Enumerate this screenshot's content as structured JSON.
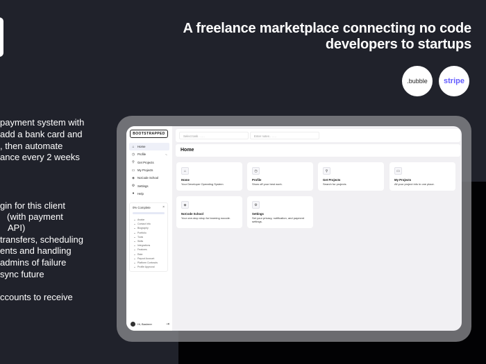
{
  "headline": [
    "A freelance marketplace connecting no code",
    "developers to startups"
  ],
  "logos": {
    "bubble": ".bubble",
    "stripe": "stripe"
  },
  "left_text": [
    "payment system with",
    "add a bank card and",
    ", then automate",
    "ance every 2 weeks",
    "gin for this client",
    "(with payment",
    "API)",
    "transfers, scheduling",
    "ents and handling",
    "admins of failure",
    "sync future",
    "ccounts to receive"
  ],
  "app": {
    "brand": "BOOTSTRAPPED",
    "nav": [
      {
        "label": "Home",
        "icon": "⌂"
      },
      {
        "label": "Profile",
        "icon": "◷",
        "badge": "‹-"
      },
      {
        "label": "Get Projects",
        "icon": "⚲"
      },
      {
        "label": "My Projects",
        "icon": "▭"
      },
      {
        "label": "NoCode School",
        "icon": "◈"
      },
      {
        "label": "Settings",
        "icon": "⚙"
      },
      {
        "label": "Help",
        "icon": "●"
      }
    ],
    "progress": {
      "title": "0% Complete",
      "close": "×",
      "progress": 0,
      "items": [
        "Avatar",
        "Contact Info",
        "Biography",
        "Portfolio",
        "Tools",
        "Skills",
        "Integrations",
        "Features",
        "Rate",
        "Payout Account",
        "Platform Contracts",
        "Profile Approval"
      ]
    },
    "user": "Hi, Basheer",
    "task_placeholder": "Select task . . . .",
    "notes_placeholder": "Enter notes . . . .",
    "page_title": "Home",
    "cards": [
      {
        "title": "Home",
        "desc": "Your Developer Operating System",
        "icon": "⌂"
      },
      {
        "title": "Profile",
        "desc": "Show off your best work.",
        "icon": "◷"
      },
      {
        "title": "Get Projects",
        "desc": "Search for projects",
        "icon": "⚲"
      },
      {
        "title": "My Projects",
        "desc": "All your project info in one place.",
        "icon": "▭"
      },
      {
        "title": "NoCode School",
        "desc": "Your one-stop shop for learning nocode.",
        "icon": "◈"
      },
      {
        "title": "Settings",
        "desc": "Set your privacy, notification, and payment settings.",
        "icon": "⚙"
      }
    ]
  }
}
